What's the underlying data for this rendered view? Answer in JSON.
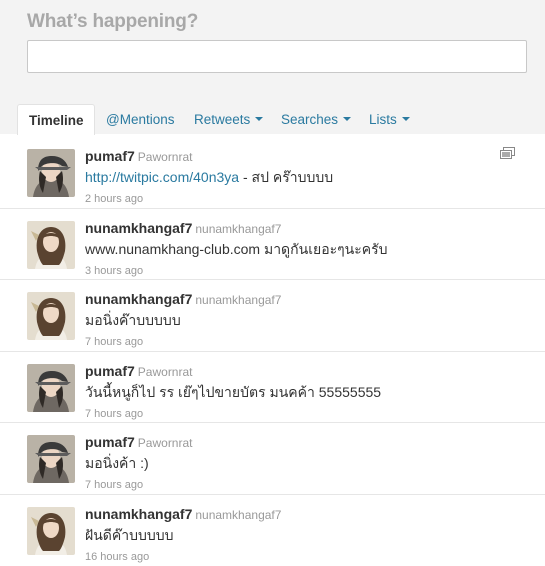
{
  "composer": {
    "title": "What’s happening?",
    "input_value": ""
  },
  "tabs": [
    {
      "label": "Timeline",
      "active": true
    },
    {
      "label": "@Mentions",
      "active": false
    },
    {
      "label": "Retweets",
      "active": false,
      "dropdown": true
    },
    {
      "label": "Searches",
      "active": false,
      "dropdown": true
    },
    {
      "label": "Lists",
      "active": false,
      "dropdown": true
    }
  ],
  "tweets": [
    {
      "screen_name": "pumaf7",
      "full_name": "Pawornrat",
      "link": "http://twitpic.com/40n3ya",
      "text": " - สป คร๊าบบบบ",
      "time": "2 hours ago",
      "avatar": "cap-girl",
      "has_media": true
    },
    {
      "screen_name": "nunamkhangaf7",
      "full_name": "nunamkhangaf7",
      "link": "",
      "text": "www.nunamkhang-club.com มาดูกันเยอะๆนะครับ",
      "time": "3 hours ago",
      "avatar": "long-hair-girl",
      "has_media": false
    },
    {
      "screen_name": "nunamkhangaf7",
      "full_name": "nunamkhangaf7",
      "link": "",
      "text": "มอนิ่งค๊าบบบบบ",
      "time": "7 hours ago",
      "avatar": "long-hair-girl",
      "has_media": false
    },
    {
      "screen_name": "pumaf7",
      "full_name": "Pawornrat",
      "link": "",
      "text": "วันนี้หนูก็ไป รร เย๊ๆไปขายบัตร มนคค้า 55555555",
      "time": "7 hours ago",
      "avatar": "cap-girl",
      "has_media": false
    },
    {
      "screen_name": "pumaf7",
      "full_name": "Pawornrat",
      "link": "",
      "text": "มอนิ่งค้า :)",
      "time": "7 hours ago",
      "avatar": "cap-girl",
      "has_media": false
    },
    {
      "screen_name": "nunamkhangaf7",
      "full_name": "nunamkhangaf7",
      "link": "",
      "text": "ฝันดีค๊าบบบบบ",
      "time": "16 hours ago",
      "avatar": "long-hair-girl",
      "has_media": false
    }
  ],
  "colors": {
    "link": "#2a7aa0",
    "composer_bg": "#f3f3f3",
    "meta": "#999999"
  },
  "icons": {
    "media": "photo-gallery-icon",
    "dropdown": "caret-down-icon"
  }
}
